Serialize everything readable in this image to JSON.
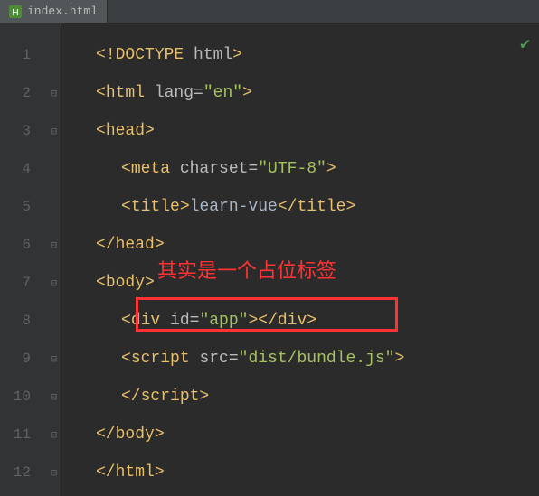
{
  "tab": {
    "filename": "index.html"
  },
  "annotation": "其实是一个占位标签",
  "lines": {
    "l1": {
      "open": "<",
      "tag": "!DOCTYPE ",
      "attr": "html",
      "close": ">"
    },
    "l2": {
      "open": "<",
      "tag": "html ",
      "attr": "lang=",
      "str": "\"en\"",
      "close": ">"
    },
    "l3": {
      "open": "<",
      "tag": "head",
      "close": ">"
    },
    "l4": {
      "open": "<",
      "tag": "meta ",
      "attr": "charset=",
      "str": "\"UTF-8\"",
      "close": ">"
    },
    "l5": {
      "open": "<",
      "tag": "title",
      "close1": ">",
      "text": "learn-vue",
      "open2": "</",
      "close2": ">"
    },
    "l6": {
      "open": "</",
      "tag": "head",
      "close": ">"
    },
    "l7": {
      "open": "<",
      "tag": "body",
      "close": ">"
    },
    "l8": {
      "open": "<",
      "tag": "div ",
      "attr": "id=",
      "str": "\"app\"",
      "close1": ">",
      "open2": "</",
      "tag2": "div",
      "close2": ">"
    },
    "l9": {
      "open": "<",
      "tag": "script ",
      "attr": "src=",
      "str": "\"dist/bundle.js\"",
      "close": ">"
    },
    "l10": {
      "open": "</",
      "tag": "script",
      "close": ">"
    },
    "l11": {
      "open": "</",
      "tag": "body",
      "close": ">"
    },
    "l12": {
      "open": "</",
      "tag": "html",
      "close": ">"
    }
  },
  "gutter": [
    "1",
    "2",
    "3",
    "4",
    "5",
    "6",
    "7",
    "8",
    "9",
    "10",
    "11",
    "12"
  ],
  "fold": [
    "",
    "⊟",
    "⊟",
    "",
    "",
    "⊟",
    "⊟",
    "",
    "⊟",
    "⊟",
    "⊟",
    "⊟"
  ]
}
